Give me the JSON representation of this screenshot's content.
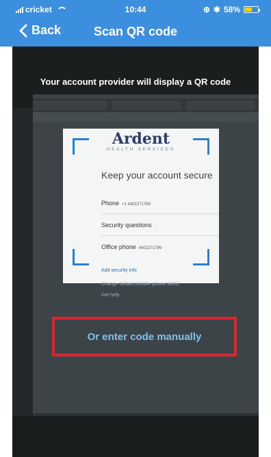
{
  "status": {
    "carrier": "cricket",
    "time": "10:44",
    "battery": "58%",
    "battery_level": 0.58
  },
  "nav": {
    "back_label": "Back",
    "title": "Scan QR code"
  },
  "camera": {
    "prompt": "Your account provider will display a QR code",
    "card": {
      "logo": "Ardent",
      "logo_sub": "HEALTH SERVICES",
      "heading": "Keep your account secure",
      "rows": [
        {
          "label": "Phone",
          "value": "+1 4402271789"
        },
        {
          "label": "Security questions",
          "value": ""
        },
        {
          "label": "Office phone",
          "value": "4402271789"
        }
      ],
      "add_link": "Add security info"
    },
    "below_card": {
      "change_default": "Change default (Mobile phone SMS)",
      "get_help": "Get help"
    },
    "manual_button": "Or enter code manually",
    "accent_color": "#2b7ed6",
    "highlight_color": "#e0232d"
  }
}
